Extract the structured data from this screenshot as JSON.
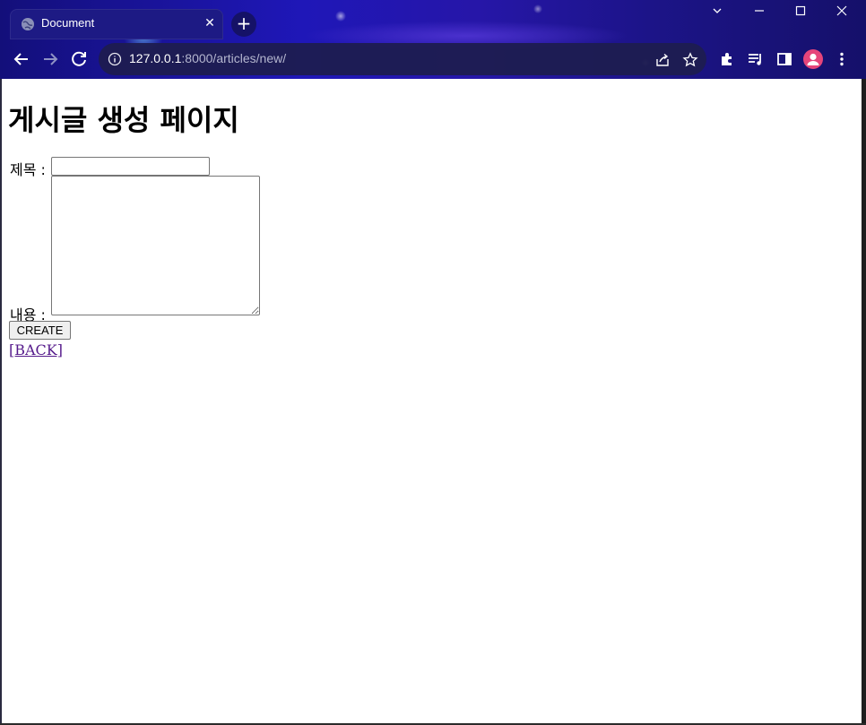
{
  "browser": {
    "tab_title": "Document",
    "tab_close": "✕",
    "new_tab": "+",
    "url_host": "127.0.0.1",
    "url_rest": ":8000/articles/new/"
  },
  "page": {
    "heading": "게시글 생성 페이지",
    "title_label": "제목 : ",
    "title_value": "",
    "content_label": "내용 : ",
    "content_value": "",
    "submit_label": "CREATE",
    "back_link": "[BACK]"
  },
  "colors": {
    "link_visited": "#551a8b",
    "chrome_accent": "#1f17b8"
  }
}
